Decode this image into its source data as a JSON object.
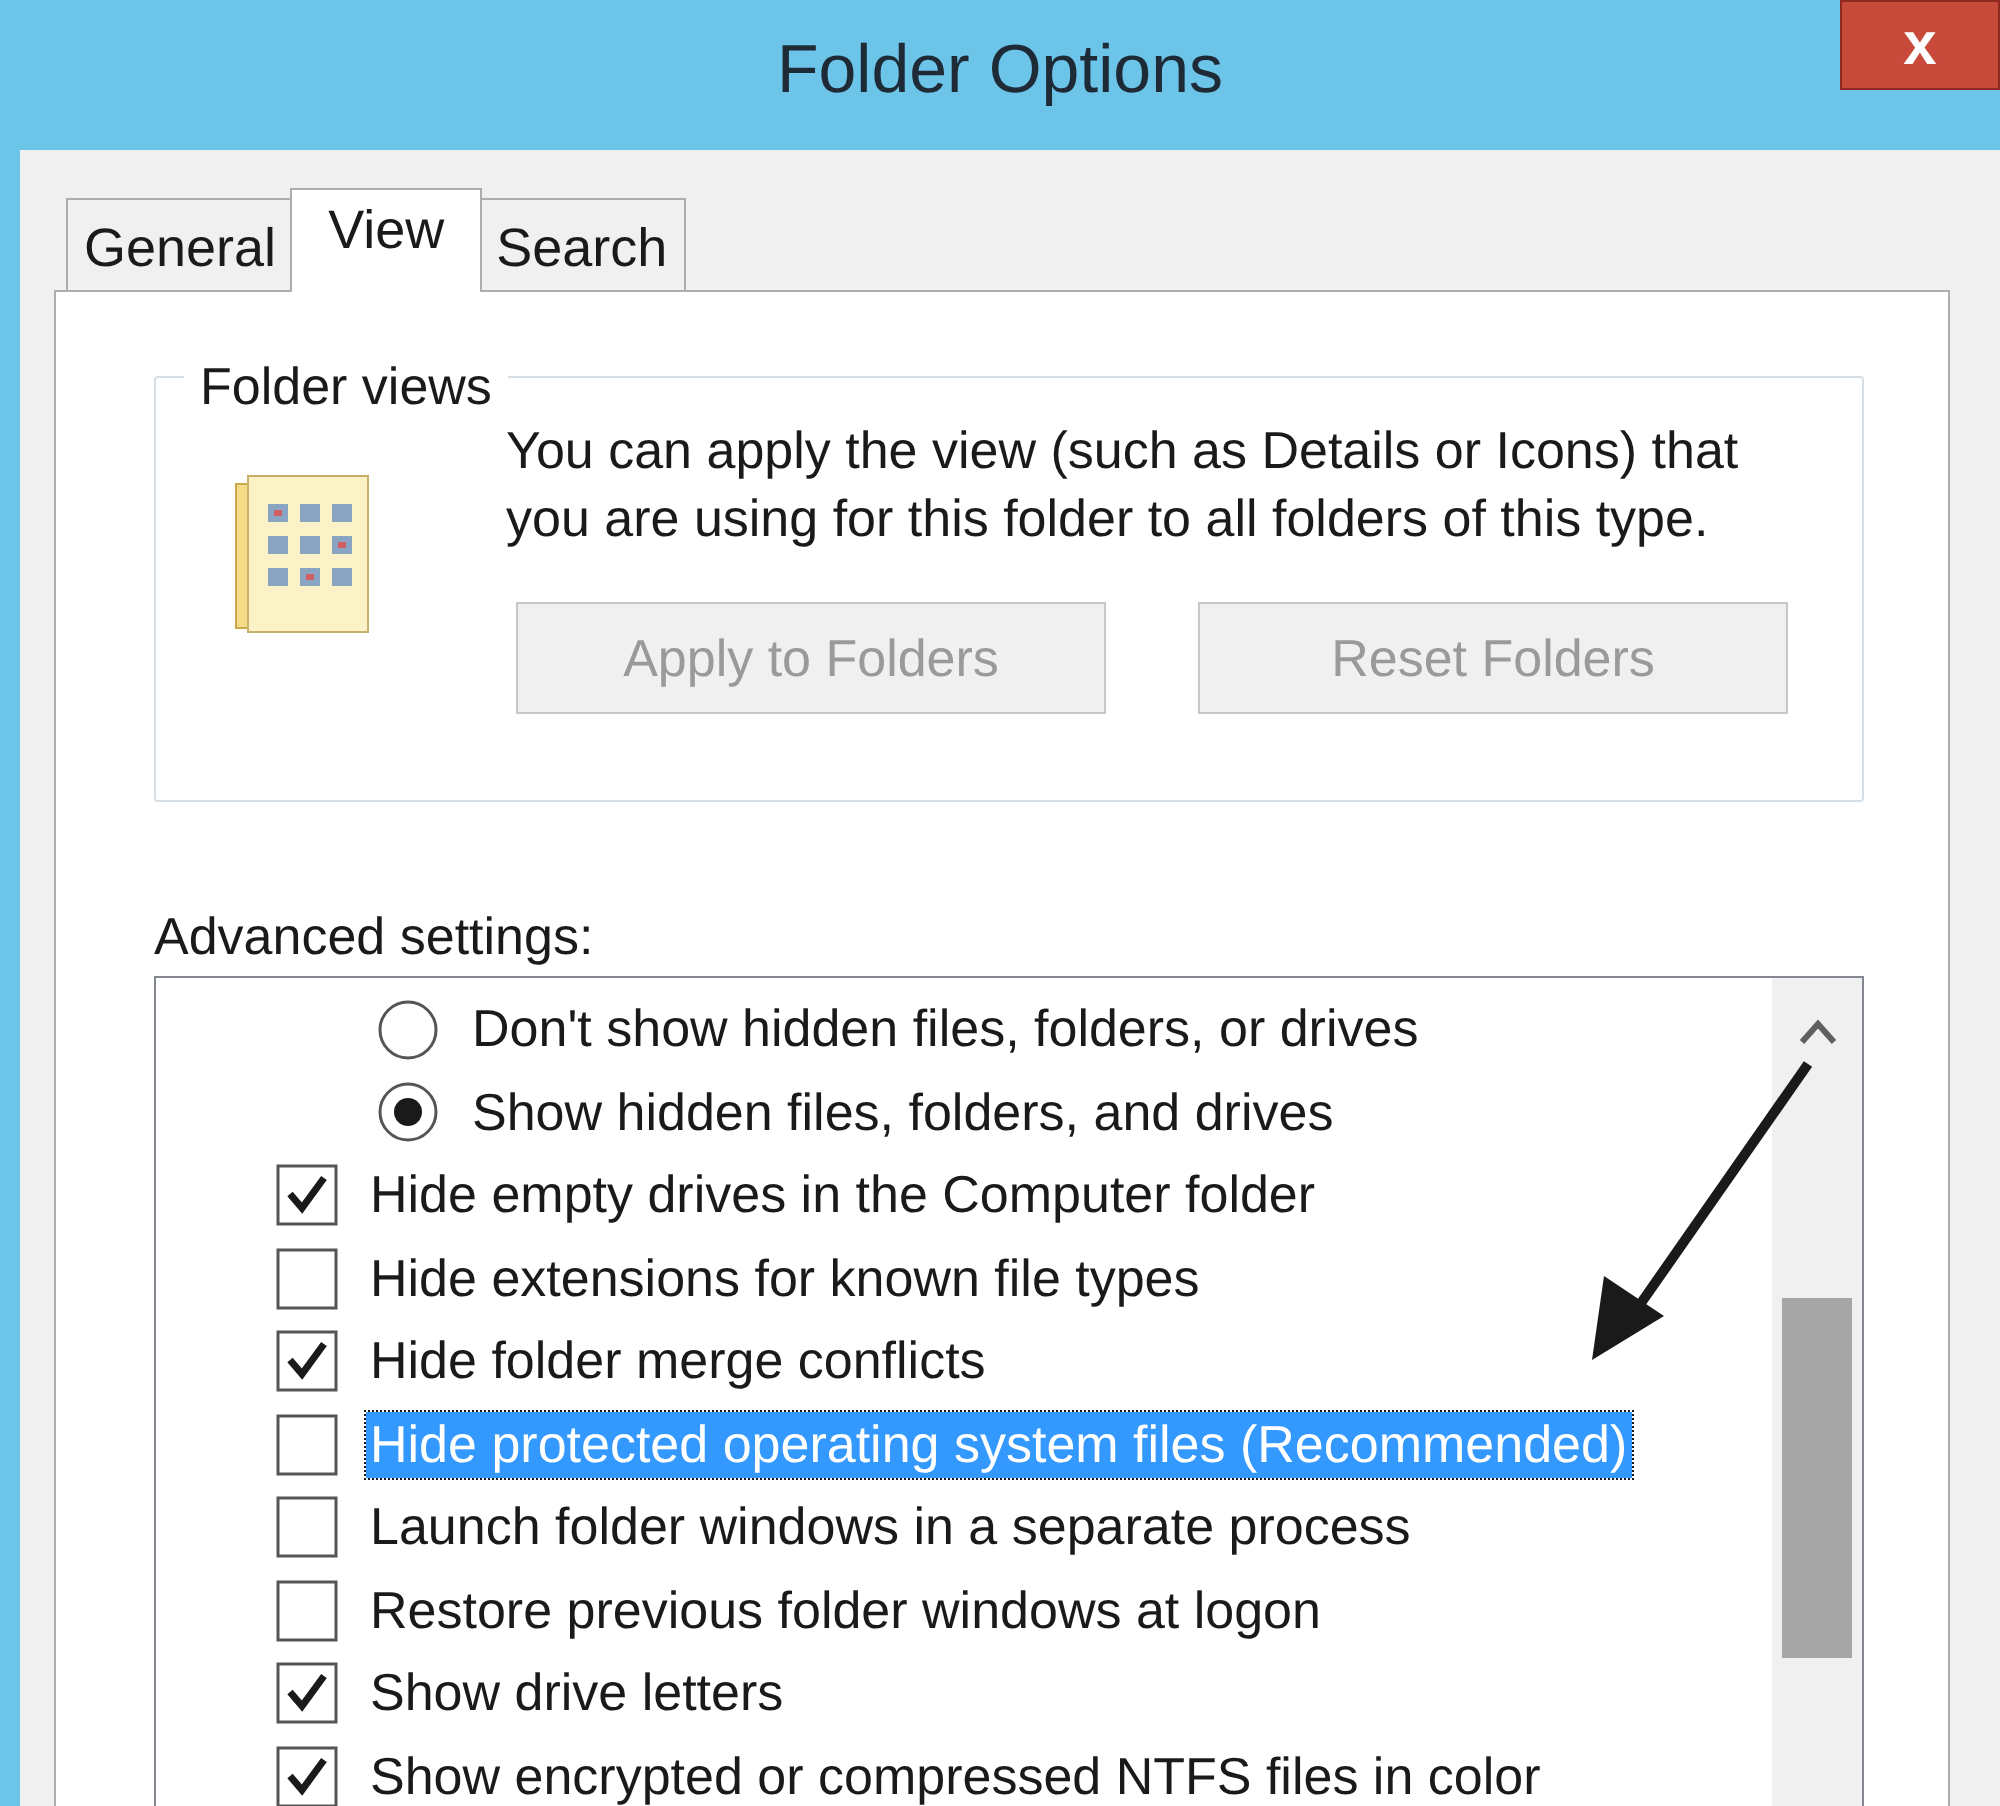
{
  "window": {
    "title": "Folder Options",
    "close": "x"
  },
  "tabs": [
    {
      "label": "General",
      "selected": false
    },
    {
      "label": "View",
      "selected": true
    },
    {
      "label": "Search",
      "selected": false
    }
  ],
  "folder_views": {
    "title": "Folder views",
    "description": "You can apply the view (such as Details or Icons) that you are using for this folder to all folders of this type.",
    "buttons": [
      {
        "label": "Apply to Folders",
        "disabled": true
      },
      {
        "label": "Reset Folders",
        "disabled": true
      }
    ]
  },
  "advanced_settings": {
    "label": "Advanced settings:",
    "items": [
      {
        "kind": "radio",
        "label": "Don't show hidden files, folders, or drives",
        "checked": false,
        "selected": false
      },
      {
        "kind": "radio",
        "label": "Show hidden files, folders, and drives",
        "checked": true,
        "selected": false
      },
      {
        "kind": "checkbox",
        "label": "Hide empty drives in the Computer folder",
        "checked": true,
        "selected": false
      },
      {
        "kind": "checkbox",
        "label": "Hide extensions for known file types",
        "checked": false,
        "selected": false
      },
      {
        "kind": "checkbox",
        "label": "Hide folder merge conflicts",
        "checked": true,
        "selected": false
      },
      {
        "kind": "checkbox",
        "label": "Hide protected operating system files (Recommended)",
        "checked": false,
        "selected": true
      },
      {
        "kind": "checkbox",
        "label": "Launch folder windows in a separate process",
        "checked": false,
        "selected": false
      },
      {
        "kind": "checkbox",
        "label": "Restore previous folder windows at logon",
        "checked": false,
        "selected": false
      },
      {
        "kind": "checkbox",
        "label": "Show drive letters",
        "checked": true,
        "selected": false
      },
      {
        "kind": "checkbox",
        "label": "Show encrypted or compressed NTFS files in color",
        "checked": true,
        "selected": false
      }
    ]
  }
}
